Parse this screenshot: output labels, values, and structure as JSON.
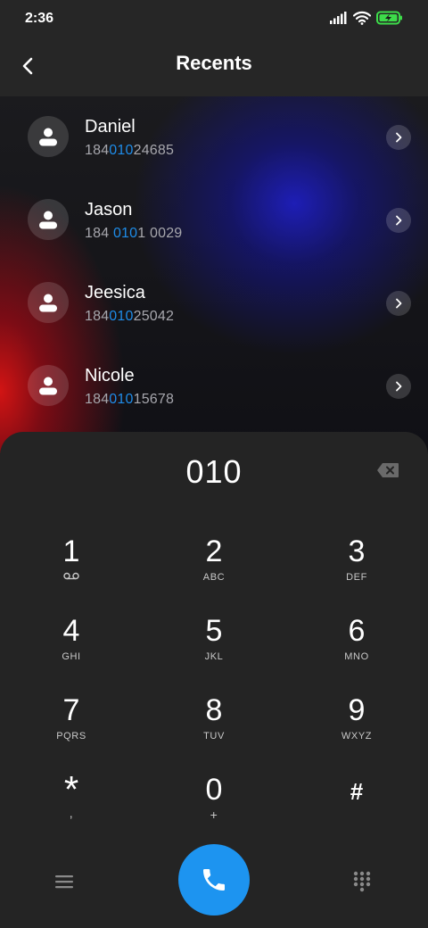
{
  "status_bar": {
    "time": "2:36",
    "icons": [
      "signal-icon",
      "wifi-icon",
      "battery-charging-icon"
    ],
    "battery_color": "#3ddc4a"
  },
  "header": {
    "title": "Recents",
    "back_icon": "back-arrow-icon"
  },
  "contacts": [
    {
      "name": "Daniel",
      "number_parts": [
        "184",
        "010",
        "24685"
      ]
    },
    {
      "name": "Jason",
      "number_parts": [
        "184 ",
        "010",
        "1 0029"
      ]
    },
    {
      "name": "Jeesica",
      "number_parts": [
        "184",
        "010",
        "25042"
      ]
    },
    {
      "name": "Nicole",
      "number_parts": [
        "184",
        "010",
        "15678"
      ]
    }
  ],
  "dialer": {
    "input_value": "010",
    "backspace_icon": "backspace-icon",
    "keys": [
      {
        "digit": "1",
        "letters": "",
        "sub_icon": "voicemail-icon"
      },
      {
        "digit": "2",
        "letters": "ABC"
      },
      {
        "digit": "3",
        "letters": "DEF"
      },
      {
        "digit": "4",
        "letters": "GHI"
      },
      {
        "digit": "5",
        "letters": "JKL"
      },
      {
        "digit": "6",
        "letters": "MNO"
      },
      {
        "digit": "7",
        "letters": "PQRS"
      },
      {
        "digit": "8",
        "letters": "TUV"
      },
      {
        "digit": "9",
        "letters": "WXYZ"
      },
      {
        "digit": "*",
        "letters": ","
      },
      {
        "digit": "0",
        "letters": "+"
      },
      {
        "digit": "#",
        "letters": ""
      }
    ],
    "bottom_icons": {
      "menu": "menu-icon",
      "call": "phone-icon",
      "keypad": "dialpad-icon"
    }
  },
  "colors": {
    "accent": "#1d94f0",
    "highlight": "#1e8ce8",
    "surface": "#242424",
    "header": "#262626"
  }
}
